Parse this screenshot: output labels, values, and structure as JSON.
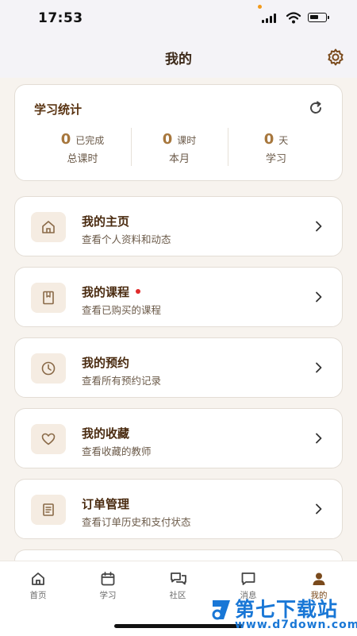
{
  "status_bar": {
    "time": "17:53"
  },
  "header": {
    "title": "我的"
  },
  "stats": {
    "title": "学习统计",
    "items": [
      {
        "value": "0",
        "unit": "已完成",
        "label": "总课时"
      },
      {
        "value": "0",
        "unit": "课时",
        "label": "本月"
      },
      {
        "value": "0",
        "unit": "天",
        "label": "学习"
      }
    ]
  },
  "menu": [
    {
      "title": "我的主页",
      "subtitle": "查看个人资料和动态",
      "icon": "home-icon"
    },
    {
      "title": "我的课程",
      "subtitle": "查看已购买的课程",
      "icon": "book-icon",
      "badge": "red-dot"
    },
    {
      "title": "我的预约",
      "subtitle": "查看所有预约记录",
      "icon": "clock-icon"
    },
    {
      "title": "我的收藏",
      "subtitle": "查看收藏的教师",
      "icon": "heart-icon"
    },
    {
      "title": "订单管理",
      "subtitle": "查看订单历史和支付状态",
      "icon": "receipt-icon"
    }
  ],
  "tabbar": {
    "tabs": [
      {
        "label": "首页",
        "icon": "home-icon"
      },
      {
        "label": "学习",
        "icon": "calendar-icon"
      },
      {
        "label": "社区",
        "icon": "chat-bubbles-icon"
      },
      {
        "label": "消息",
        "icon": "message-icon"
      },
      {
        "label": "我的",
        "icon": "person-icon",
        "active": true
      }
    ]
  },
  "watermark": {
    "brand": "第七下载站",
    "url": "www.d7down.com"
  },
  "colors": {
    "accent": "#a7773d",
    "title": "#4a2b10",
    "background": "#f7f3ee",
    "badge": "#e02b2b",
    "active_tab": "#7a4a1c"
  }
}
